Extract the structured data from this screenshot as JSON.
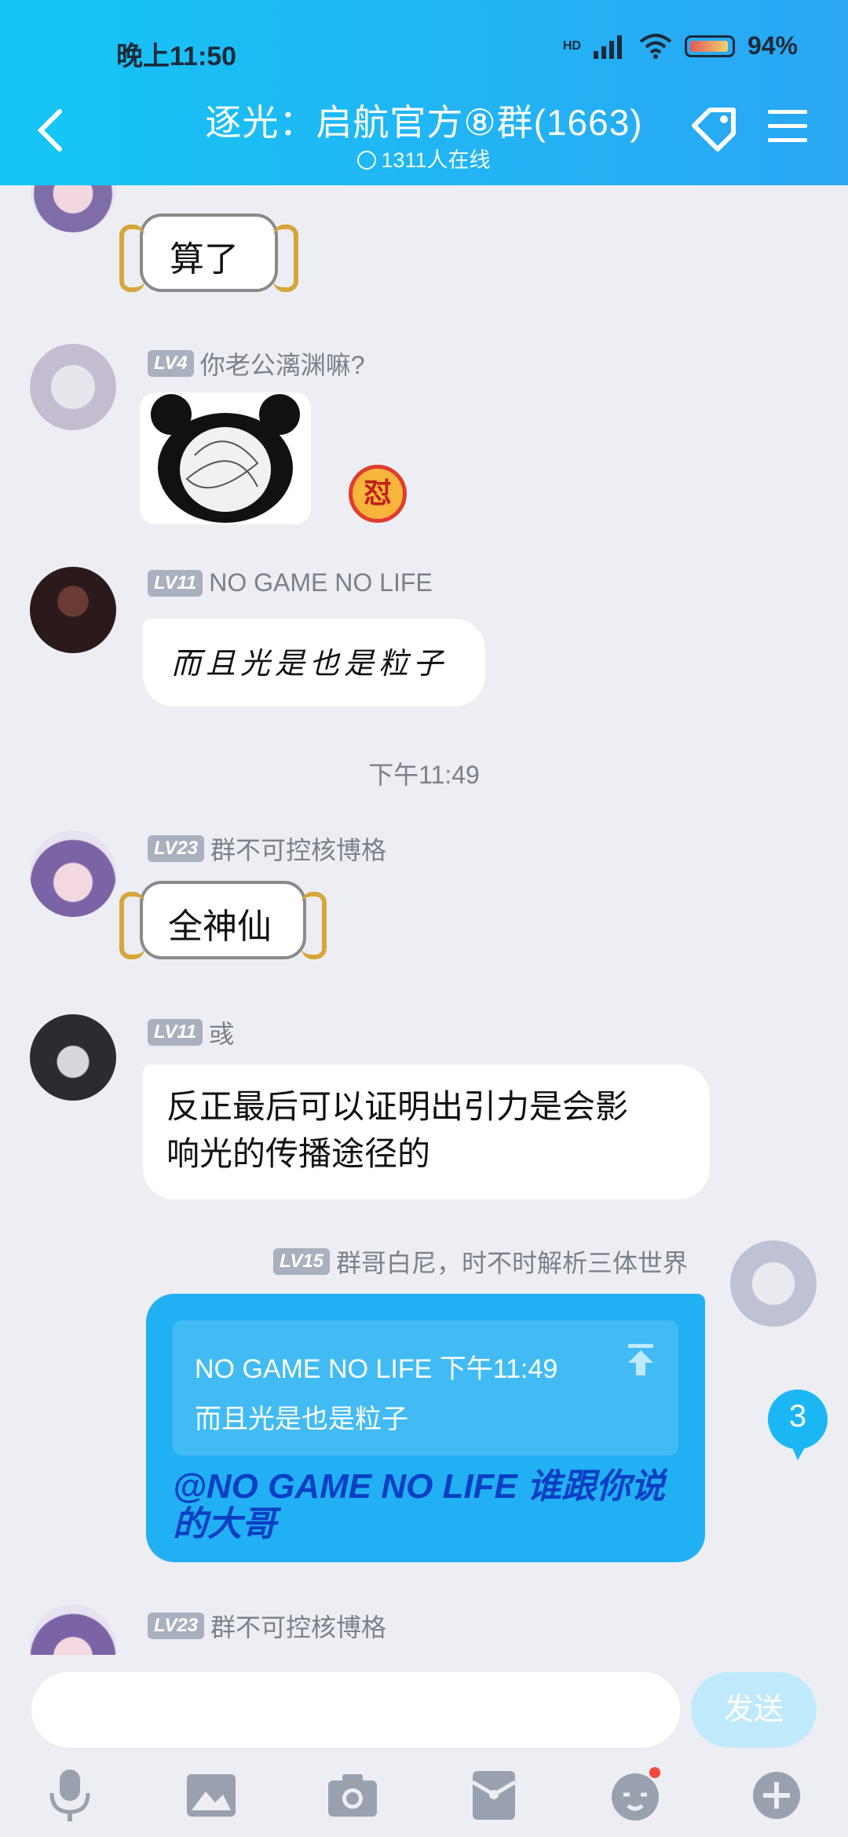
{
  "status_bar": {
    "time": "晚上11:50",
    "battery": "94%",
    "hd_label": "HD"
  },
  "header": {
    "title": "逐光：启航官方⑧群(1663)",
    "online": "1311人在线"
  },
  "messages": [
    {
      "type": "mask",
      "sender_lv": "",
      "sender": "",
      "text": "算了"
    },
    {
      "type": "sticker",
      "sender_lv": "LV4",
      "sender": "你老公漓渊嘛?",
      "badge": "怼"
    },
    {
      "type": "text",
      "sender_lv": "LV11",
      "sender": "NO GAME NO LIFE",
      "text": "而且光是也是粒子"
    },
    {
      "type": "time",
      "text": "下午11:49"
    },
    {
      "type": "mask",
      "sender_lv": "LV23",
      "sender": "群不可控核博格",
      "text": "全神仙"
    },
    {
      "type": "text",
      "sender_lv": "LV11",
      "sender": "彧",
      "line1": "反正最后可以证明出引力是会影",
      "line2": "响光的传播途径的"
    },
    {
      "type": "reply",
      "sender_lv": "LV15",
      "sender": "群哥白尼，时不时解析三体世界",
      "quote_header": "NO GAME NO LIFE 下午11:49",
      "quote_text": "而且光是也是粒子",
      "line1": "@NO GAME NO LIFE 谁跟你说",
      "line2": "的大哥"
    },
    {
      "type": "partial",
      "sender_lv": "LV23",
      "sender": "群不可控核博格"
    }
  ],
  "unread_count": "3",
  "input": {
    "send_label": "发送"
  },
  "toolbar": [
    "mic-icon",
    "image-icon",
    "camera-icon",
    "red-packet-icon",
    "emoji-icon",
    "plus-icon"
  ]
}
